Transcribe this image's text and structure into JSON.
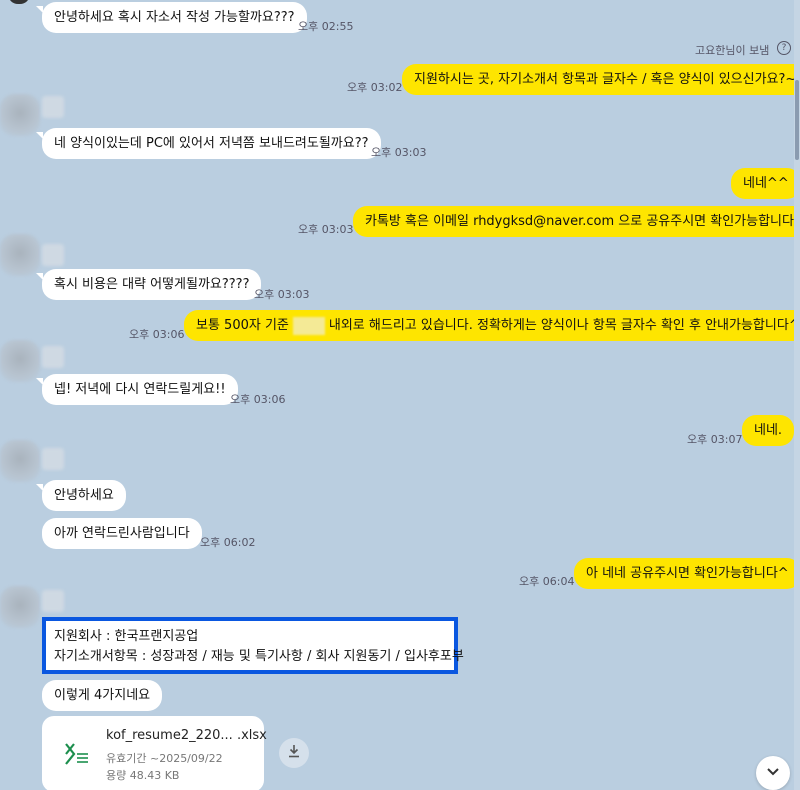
{
  "messages": {
    "m1": {
      "text": "안녕하세요 혹시 자소서 작성 가능할까요???",
      "time": "오후 02:55"
    },
    "sender_note": "고요한님이 보냄",
    "m2": {
      "text": "지원하시는 곳, 자기소개서 항목과 글자수 / 혹은 양식이 있으신가요?~",
      "time": "오후 03:02"
    },
    "m3": {
      "text": "네 양식이있는데 PC에 있어서 저녁쯤 보내드려도될까요??",
      "time": "오후 03:03"
    },
    "m4": {
      "text": "네네^^"
    },
    "m5": {
      "text": "카톡방 혹은 이메일 rhdygksd@naver.com 으로 공유주시면 확인가능합니다.",
      "time": "오후 03:03"
    },
    "m6": {
      "text": "혹시 비용은 대략 어떻게될까요????",
      "time": "오후 03:03"
    },
    "m7": {
      "text_before": "보통 500자 기준",
      "text_after": "내외로 해드리고 있습니다. 정확하게는 양식이나 항목 글자수 확인 후 안내가능합니다^^",
      "time": "오후 03:06"
    },
    "m8": {
      "text": "넵! 저녁에 다시 연락드릴게요!!",
      "time": "오후 03:06"
    },
    "m9": {
      "text": "네네.",
      "time": "오후 03:07"
    },
    "m10": {
      "text": "안녕하세요"
    },
    "m11": {
      "text": "아까 연락드린사람입니다",
      "time": "오후 06:02"
    },
    "m12": {
      "text": "아 네네 공유주시면 확인가능합니다^",
      "time": "오후 06:04"
    },
    "m13": {
      "line1": "지원회사 : 한국프랜지공업",
      "line2": "자기소개서항목 : 성장과정 / 재능 및 특기사항 / 회사 지원동기 / 입사후포부"
    },
    "m14": {
      "text": "이렇게 4가지네요"
    }
  },
  "file": {
    "name": "kof_resume2_220... .xlsx",
    "expiry": "유효기간 ~2025/09/22",
    "size": "용량 48.43 KB",
    "icon": "excel-file-icon"
  },
  "icons": {
    "help": "help-circle-icon",
    "download": "download-icon",
    "scroll_down": "chevron-down-icon"
  },
  "colors": {
    "background": "#bacee0",
    "my_bubble": "#fee500",
    "other_bubble": "#ffffff",
    "highlight_border": "#0a57e0",
    "excel_green": "#1d8f4e"
  }
}
